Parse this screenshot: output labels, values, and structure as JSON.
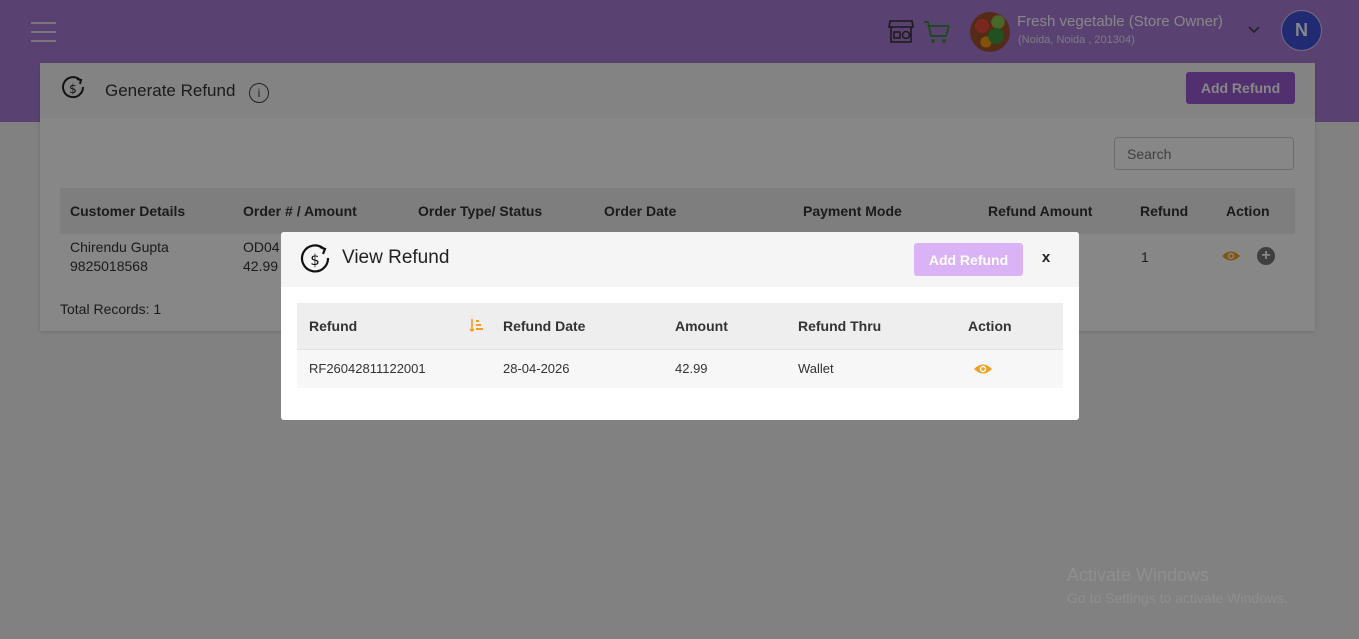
{
  "header": {
    "store_name": "Fresh vegetable (Store Owner)",
    "store_address": "(Noida, Noida , 201304)",
    "user_initial": "N",
    "icons": [
      "menu-icon",
      "store-icon",
      "cart-icon",
      "chevron-down-icon"
    ]
  },
  "page": {
    "title": "Generate Refund",
    "info_glyph": "i",
    "add_button": "Add Refund",
    "search_placeholder": "Search",
    "columns": [
      "Customer Details",
      "Order # / Amount",
      "Order Type/ Status",
      "Order Date",
      "Payment Mode",
      "Refund Amount",
      "Refund",
      "Action"
    ],
    "rows": [
      {
        "customer_name": "Chirendu Gupta",
        "customer_phone": "9825018568",
        "order_id": "OD04",
        "order_amount": "42.99",
        "refund": "1"
      }
    ],
    "total_records": "Total Records: 1",
    "plus_glyph": "+"
  },
  "modal": {
    "title": "View Refund",
    "add_button": "Add Refund",
    "close": "x",
    "columns": [
      "Refund",
      "Refund Date",
      "Amount",
      "Refund Thru",
      "Action"
    ],
    "rows": [
      {
        "refund": "RF26042811122001",
        "refund_date": "28-04-2026",
        "amount": "42.99",
        "refund_thru": "Wallet"
      }
    ]
  },
  "watermark": {
    "line1": "Activate Windows",
    "line2": "Go to Settings to activate Windows."
  },
  "colors": {
    "brand": "#a87ed8",
    "button": "#9b59d0",
    "button_disabled": "#d9b3f5",
    "accent_orange": "#f0a020",
    "avatar": "#3f51d9"
  }
}
